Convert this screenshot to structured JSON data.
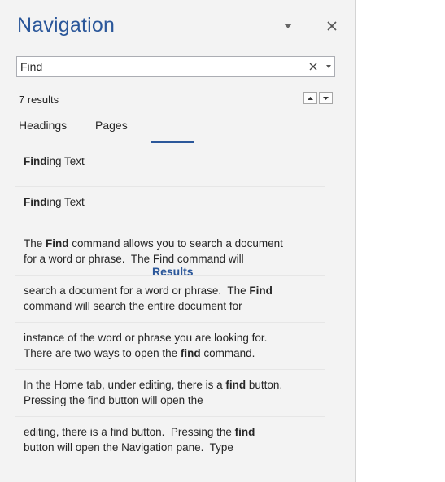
{
  "pane": {
    "title": "Navigation",
    "menu_icon": "chevron-down-icon",
    "close_icon": "close-icon"
  },
  "search": {
    "value": "Find",
    "clear_icon": "close-icon",
    "dropdown_icon": "chevron-down-icon"
  },
  "results_info": {
    "count_text": "7 results",
    "prev_icon": "triangle-up-icon",
    "next_icon": "triangle-down-icon"
  },
  "tabs": [
    {
      "label": "Headings",
      "active": false
    },
    {
      "label": "Pages",
      "active": false
    },
    {
      "label": "Results",
      "active": true
    }
  ],
  "results": [
    {
      "lines": [
        [
          {
            "t": "Find",
            "b": true
          },
          {
            "t": "ing Text",
            "b": false
          }
        ]
      ]
    },
    {
      "lines": [
        [
          {
            "t": "Find",
            "b": true
          },
          {
            "t": "ing Text",
            "b": false
          }
        ]
      ]
    },
    {
      "lines": [
        [
          {
            "t": "The ",
            "b": false
          },
          {
            "t": "Find",
            "b": true
          },
          {
            "t": " command allows you to search a document",
            "b": false
          }
        ],
        [
          {
            "t": "for a word or phrase.  The Find command will",
            "b": false
          }
        ]
      ]
    },
    {
      "lines": [
        [
          {
            "t": "search a document for a word or phrase.  The ",
            "b": false
          },
          {
            "t": "Find",
            "b": true
          }
        ],
        [
          {
            "t": "command will search the entire document for",
            "b": false
          }
        ]
      ]
    },
    {
      "lines": [
        [
          {
            "t": "instance of the word or phrase you are looking for.",
            "b": false
          }
        ],
        [
          {
            "t": "There are two ways to open the ",
            "b": false
          },
          {
            "t": "find",
            "b": true
          },
          {
            "t": " command.",
            "b": false
          }
        ]
      ]
    },
    {
      "lines": [
        [
          {
            "t": "In the Home tab, under editing, there is a ",
            "b": false
          },
          {
            "t": "find",
            "b": true
          },
          {
            "t": " button.",
            "b": false
          }
        ],
        [
          {
            "t": "Pressing the find button will open the",
            "b": false
          }
        ]
      ]
    },
    {
      "lines": [
        [
          {
            "t": "editing, there is a find button.  Pressing the ",
            "b": false
          },
          {
            "t": "find",
            "b": true
          }
        ],
        [
          {
            "t": "button will open the Navigation pane.  Type",
            "b": false
          }
        ]
      ]
    }
  ],
  "colors": {
    "accent": "#2b579a",
    "pane_bg": "#f3f3f3",
    "doc_bg": "#ffffff"
  }
}
